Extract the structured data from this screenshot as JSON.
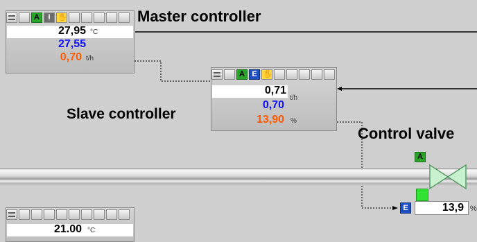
{
  "master": {
    "title": "Master controller",
    "pv": "27,95",
    "pv_unit": "°C",
    "sp": "27,55",
    "out": "0,70",
    "out_unit": "t/h",
    "btn_auto": "A",
    "btn_int": "I"
  },
  "slave": {
    "title": "Slave controller",
    "pv": "0,71",
    "pv_unit": "t/h",
    "sp": "0,70",
    "out": "13,90",
    "out_unit": "%",
    "btn_auto": "A",
    "btn_ext": "E"
  },
  "valve": {
    "title": "Control valve",
    "mode": "A",
    "ext_label": "E",
    "position": "13,9",
    "unit": "%"
  },
  "lower": {
    "pv": "21.00",
    "pv_unit": "°C"
  },
  "colors": {
    "pv": "#000000",
    "sp": "#1010ff",
    "out": "#ff5a00",
    "auto": "#2aa32a",
    "ext": "#1e4fc1",
    "valve_fill": "#c8f2cf",
    "valve_stroke": "#5a9a6a"
  }
}
